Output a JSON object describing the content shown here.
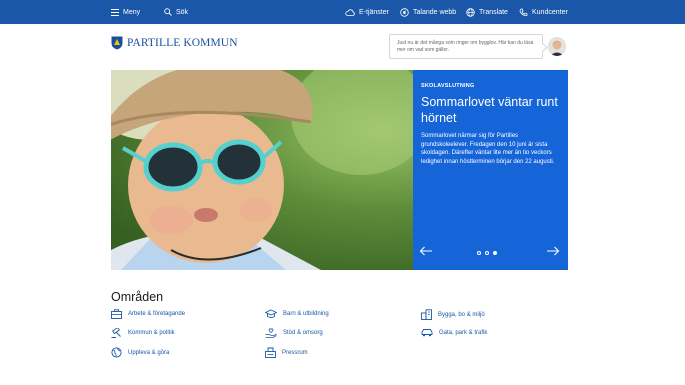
{
  "topbar": {
    "menu_label": "Meny",
    "search_label": "Sök",
    "eservices_label": "E-tjänster",
    "talking_web_label": "Talande webb",
    "translate_label": "Translate",
    "customer_center_label": "Kundcenter"
  },
  "header": {
    "logo_text": "PARTILLE KOMMUN",
    "notice_text": "Just nu är det många som ringer om bygglov. Här kan du läsa mer om vad som gäller."
  },
  "hero": {
    "kicker": "SKOLAVSLUTNING",
    "headline": "Sommarlovet väntar runt hörnet",
    "body": "Sommarlovet närmar sig för Partilles grundskoleelever. Fredagen den 10 juni är sista skoldagen. Därefter väntar lite mer än tio veckors ledighet innan höstterminen börjar den 22 augusti.",
    "slide_count": 3,
    "active_slide": 3
  },
  "areas": {
    "title": "Områden",
    "items": [
      {
        "label": "Arbete & företagande",
        "icon": "briefcase-icon"
      },
      {
        "label": "Kommun & politik",
        "icon": "gavel-icon"
      },
      {
        "label": "Uppleva & göra",
        "icon": "globe-icon"
      },
      {
        "label": "Barn & utbildning",
        "icon": "graduation-cap-icon"
      },
      {
        "label": "Stöd & omsorg",
        "icon": "heart-hand-icon"
      },
      {
        "label": "Pressrum",
        "icon": "press-icon"
      },
      {
        "label": "Bygga, bo & miljö",
        "icon": "buildings-icon"
      },
      {
        "label": "Gata, park & trafik",
        "icon": "car-icon"
      }
    ]
  },
  "colors": {
    "topbar": "#1a57a8",
    "hero_panel": "#1565d8",
    "link": "#1a57a8"
  }
}
